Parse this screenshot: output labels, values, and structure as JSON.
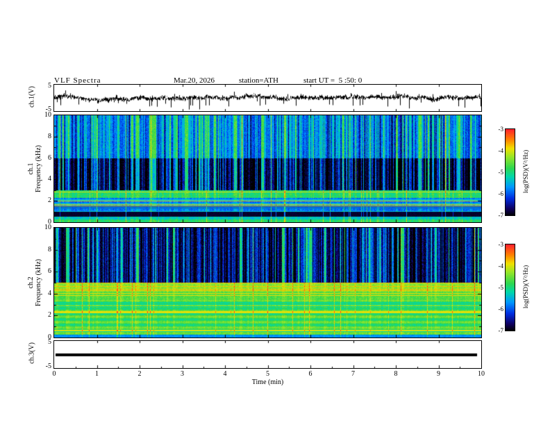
{
  "header": {
    "title": "VLF Spectra",
    "date": "Mar.20, 2026",
    "station": "station=ATH",
    "start_ut": "start UT =  5 :50: 0"
  },
  "panels": {
    "ch1_wave": {
      "ylabel": "ch.1(V)",
      "ymax_label": "5",
      "ymin_label": "-5"
    },
    "ch1_spec": {
      "name_label": "ch.1",
      "freq_label": "Frequency  (kHz)",
      "yticks": [
        "10",
        "8",
        "6",
        "4",
        "2",
        "0"
      ]
    },
    "ch2_spec": {
      "name_label": "ch.2",
      "freq_label": "Frequency  (kHz)",
      "yticks": [
        "10",
        "8",
        "6",
        "4",
        "2",
        "0"
      ]
    },
    "ch3_wave": {
      "ylabel": "ch.3(V)",
      "ymax_label": "5",
      "ymin_label": "-5"
    }
  },
  "xaxis": {
    "label": "Time  (min)",
    "ticks": [
      "0",
      "1",
      "2",
      "3",
      "4",
      "5",
      "6",
      "7",
      "8",
      "9",
      "10"
    ]
  },
  "colorbars": [
    {
      "label": "log(PSD)(V²/Hz)",
      "ticks": [
        "-3",
        "-4",
        "-5",
        "-6",
        "-7"
      ]
    },
    {
      "label": "log(PSD)(V²/Hz)",
      "ticks": [
        "-3",
        "-4",
        "-5",
        "-6",
        "-7"
      ]
    }
  ],
  "chart_data": [
    {
      "type": "line",
      "title": "ch.1 time series",
      "xlabel": "Time  (min)",
      "ylabel": "ch.1(V)",
      "xlim": [
        0,
        10
      ],
      "ylim": [
        -5,
        5
      ],
      "description": "Broadband noise waveform centered near 0 V with roughly ±2 V fluctuations and intermittent impulsive spikes reaching about -5 V across the full 10-minute record."
    },
    {
      "type": "heatmap",
      "title": "ch.1 spectrogram",
      "xlabel": "Time  (min)",
      "ylabel": "Frequency  (kHz)",
      "zlabel": "log(PSD)(V²/Hz)",
      "xlim": [
        0,
        10
      ],
      "ylim": [
        0,
        10
      ],
      "zlim": [
        -7,
        -3
      ],
      "legend_position": "right colorbar",
      "description": "Green background PSD near -4.7 with dense dark-blue vertical dropouts (PSD near -7) strongest between about 3 and 6 kHz, a cyan band from roughly 1 to 2.3 kHz, narrow yellow-orange horizontal lines near 2-3 kHz, and a near-black horizontal band around 0.5-1 kHz."
    },
    {
      "type": "heatmap",
      "title": "ch.2 spectrogram",
      "xlabel": "Time  (min)",
      "ylabel": "Frequency  (kHz)",
      "zlabel": "log(PSD)(V²/Hz)",
      "xlim": [
        0,
        10
      ],
      "ylim": [
        0,
        10
      ],
      "zlim": [
        -7,
        -3
      ],
      "legend_position": "right colorbar",
      "description": "Dense dark-blue vertical streaks above about 5 kHz over a green background, a yellow-orange enhanced band near 4.2-5 kHz, and yellow-green levels with fine orange horizontal banding below about 3.4 kHz."
    },
    {
      "type": "line",
      "title": "ch.3 time series",
      "xlabel": "Time  (min)",
      "ylabel": "ch.3(V)",
      "xlim": [
        0,
        10
      ],
      "ylim": [
        -5,
        5
      ],
      "description": "Constant flat trace at 0 V drawn as a thick black line (no signal on channel 3)."
    }
  ]
}
